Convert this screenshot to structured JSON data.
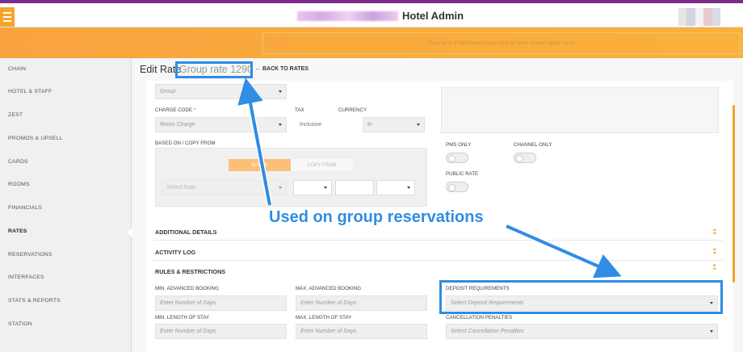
{
  "header": {
    "title": "Hotel Admin"
  },
  "quickbar": {
    "drop_text": "Drop up to 8 dashboard icons here for your custom quick menu"
  },
  "sidebar": {
    "items": [
      {
        "label": "CHAIN"
      },
      {
        "label": "HOTEL & STAFF"
      },
      {
        "label": "ZEST"
      },
      {
        "label": "PROMOS & UPSELL"
      },
      {
        "label": "CARDS"
      },
      {
        "label": "ROOMS"
      },
      {
        "label": "FINANCIALS"
      },
      {
        "label": "RATES"
      },
      {
        "label": "RESERVATIONS"
      },
      {
        "label": "INTERFACES"
      },
      {
        "label": "STATS & REPORTS"
      },
      {
        "label": "STATION"
      }
    ],
    "active": "RATES"
  },
  "page": {
    "title_prefix": "Edit Rate",
    "rate_name": "Group rate 1290",
    "back_link": "BACK TO RATES"
  },
  "form": {
    "rate_type": {
      "value": "Group"
    },
    "charge_code": {
      "label": "CHARGE CODE",
      "required_mark": "*",
      "placeholder": "Room Charge"
    },
    "tax": {
      "label": "TAX",
      "value": "Inclusive"
    },
    "currency": {
      "label": "CURRENCY",
      "value": "kr"
    },
    "based_on": {
      "label": "BASED ON / COPY FROM",
      "segments": [
        "BASED",
        "COPY FROM"
      ],
      "select_placeholder": "Select Rate"
    },
    "pms_only": {
      "label": "PMS ONLY",
      "on": false
    },
    "channel_only": {
      "label": "CHANNEL ONLY",
      "on": false
    },
    "public_rate": {
      "label": "PUBLIC RATE",
      "on": false
    }
  },
  "sections": {
    "additional_details": "ADDITIONAL DETAILS",
    "activity_log": "ACTIVITY LOG",
    "rules": "RULES & RESTRICTIONS"
  },
  "rules": {
    "min_advanced_booking": {
      "label": "MIN. ADVANCED BOOKING",
      "placeholder": "Enter Number of Days"
    },
    "max_advanced_booking": {
      "label": "MAX. ADVANCED BOOKING",
      "placeholder": "Enter Number of Days"
    },
    "deposit_requirements": {
      "label": "DEPOSIT REQUIREMENTS",
      "placeholder": "Select Deposit Requirements"
    },
    "min_length_of_stay": {
      "label": "MIN. LENGTH OF STAY",
      "placeholder": "Enter Number of Days"
    },
    "max_length_of_stay": {
      "label": "MAX. LENGTH OF STAY",
      "placeholder": "Enter Number of Days"
    },
    "cancellation_penalties": {
      "label": "CANCELLATION PENALTIES",
      "placeholder": "Select Cancellation Penalties"
    }
  },
  "annotation": {
    "callout": "Used on group reservations",
    "color": "#2f8de4"
  },
  "colors": {
    "accent": "#f5a52a",
    "brand_purple": "#7d2c8a"
  },
  "icons": {
    "menu": "hamburger-icon",
    "back": "arrow-left-icon",
    "expand": "double-chevron-down-icon",
    "collapse": "double-chevron-up-icon"
  }
}
